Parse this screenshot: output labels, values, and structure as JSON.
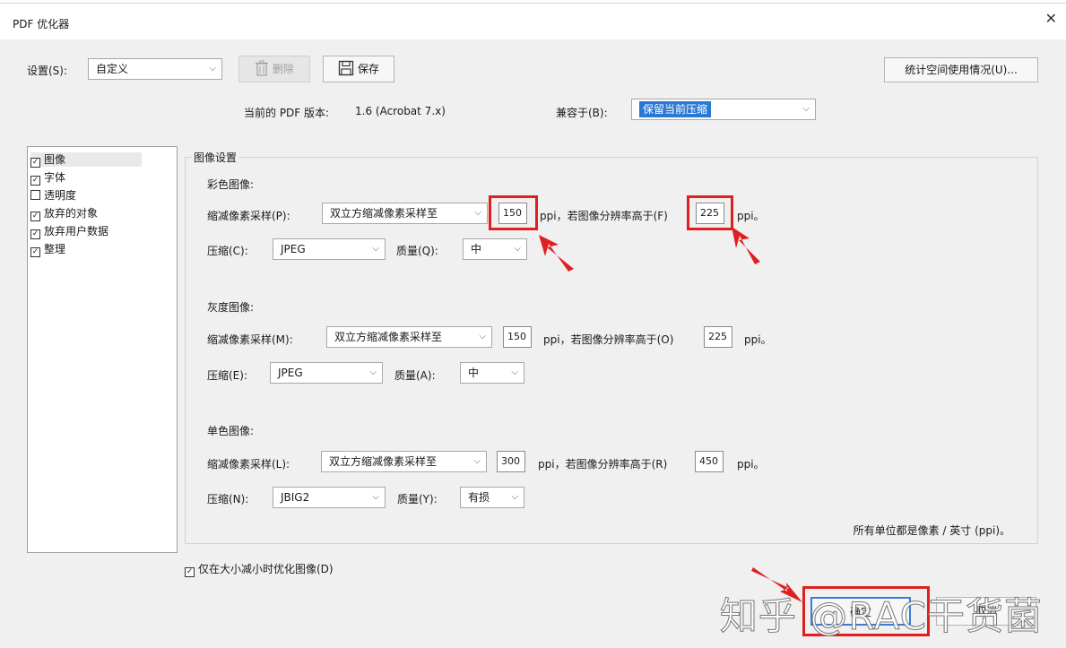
{
  "window": {
    "title": "PDF 优化器",
    "close_glyph": "✕"
  },
  "settings": {
    "label": "设置(S):",
    "value": "自定义",
    "delete_label": "删除",
    "save_label": "保存",
    "stats_label": "统计空间使用情况(U)..."
  },
  "version": {
    "label": "当前的 PDF 版本:",
    "value": "1.6 (Acrobat 7.x)",
    "compat_label": "兼容于(B):",
    "compat_value": "保留当前压缩"
  },
  "sidebar": {
    "items": [
      {
        "label": "图像",
        "checked": true
      },
      {
        "label": "字体",
        "checked": true
      },
      {
        "label": "透明度",
        "checked": false
      },
      {
        "label": "放弃的对象",
        "checked": true
      },
      {
        "label": "放弃用户数据",
        "checked": true
      },
      {
        "label": "整理",
        "checked": true
      }
    ]
  },
  "image_settings": {
    "group_title": "图像设置",
    "color": {
      "heading": "彩色图像:",
      "downsample_label": "缩减像素采样(P):",
      "downsample_value": "双立方缩减像素采样至",
      "ppi1": "150",
      "mid_text": "ppi，若图像分辨率高于(F)",
      "ppi2": "225",
      "end_text": "ppi。",
      "compress_label": "压缩(C):",
      "compress_value": "JPEG",
      "quality_label": "质量(Q):",
      "quality_value": "中"
    },
    "gray": {
      "heading": "灰度图像:",
      "downsample_label": "缩减像素采样(M):",
      "downsample_value": "双立方缩减像素采样至",
      "ppi1": "150",
      "mid_text": "ppi，若图像分辨率高于(O)",
      "ppi2": "225",
      "end_text": "ppi。",
      "compress_label": "压缩(E):",
      "compress_value": "JPEG",
      "quality_label": "质量(A):",
      "quality_value": "中"
    },
    "mono": {
      "heading": "单色图像:",
      "downsample_label": "缩减像素采样(L):",
      "downsample_value": "双立方缩减像素采样至",
      "ppi1": "300",
      "mid_text": "ppi，若图像分辨率高于(R)",
      "ppi2": "450",
      "end_text": "ppi。",
      "compress_label": "压缩(N):",
      "compress_value": "JBIG2",
      "quality_label": "质量(Y):",
      "quality_value": "有损"
    },
    "units_note": "所有单位都是像素 / 英寸 (ppi)。"
  },
  "optimize_only": {
    "label": "仅在大小减小时优化图像(D)",
    "checked": true
  },
  "footer": {
    "ok_label": "确定",
    "cancel_label": "取消"
  },
  "watermark": "知乎 @RAC干货菌",
  "colors": {
    "highlight": "#e02020",
    "selection": "#2a78d4"
  }
}
